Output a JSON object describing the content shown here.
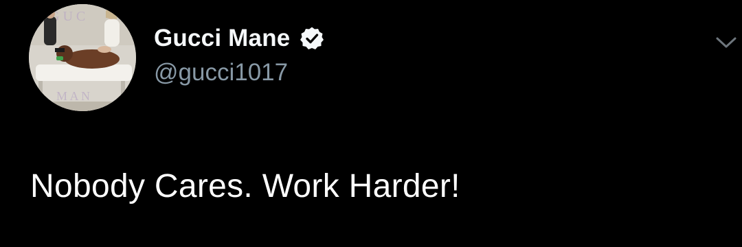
{
  "tweet": {
    "author": {
      "display_name": "Gucci Mane",
      "handle": "@gucci1017",
      "verified": true,
      "avatar": "profile-photo"
    },
    "text": "Nobody Cares. Work Harder!",
    "menu_icon": "chevron-down-icon",
    "verified_icon": "verified-badge-icon"
  },
  "colors": {
    "background": "#000000",
    "name": "#f5f8fa",
    "handle": "#8899a6",
    "text": "#ffffff",
    "chevron": "#6e767d"
  }
}
